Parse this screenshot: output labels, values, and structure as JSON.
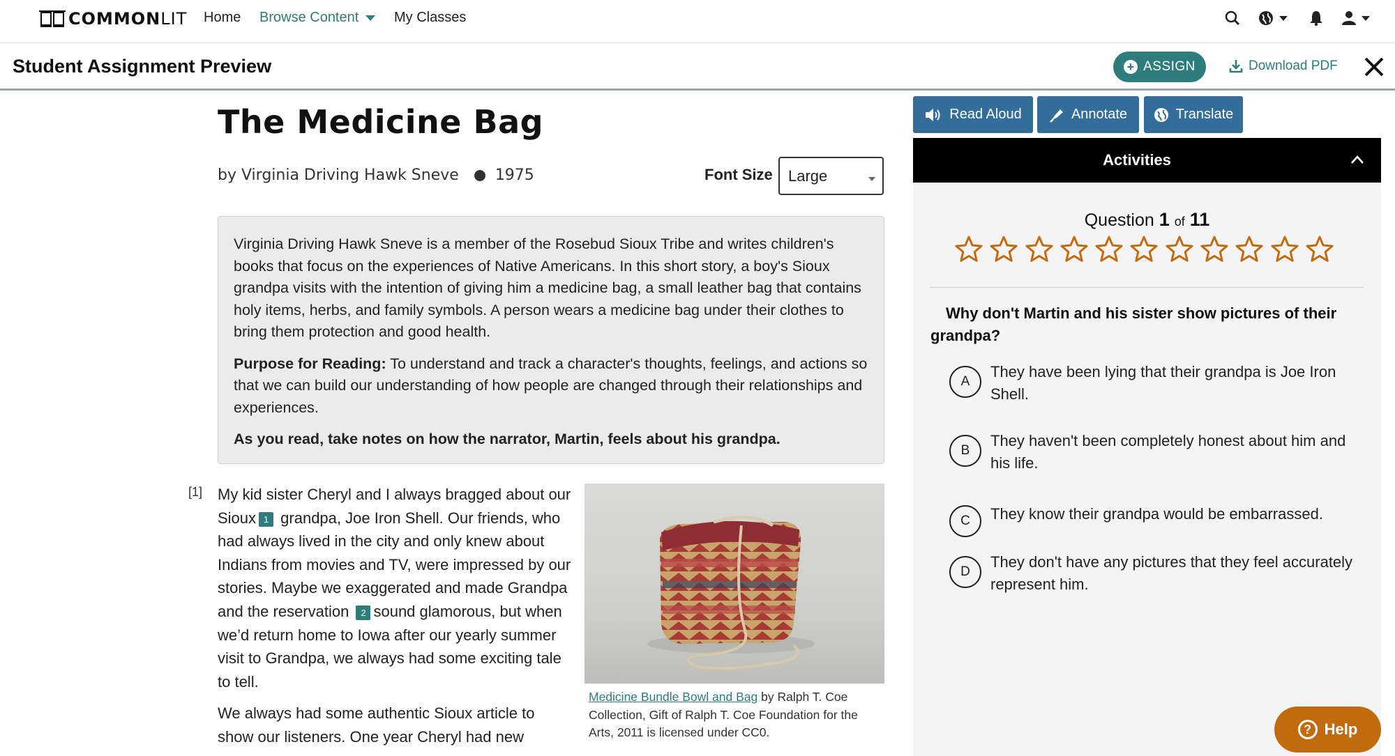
{
  "nav": {
    "logo_bold": "COMMON",
    "logo_light": "LIT",
    "links": [
      "Home",
      "Browse Content",
      "My Classes"
    ]
  },
  "subheader": {
    "title": "Student Assignment Preview",
    "assign_label": "ASSIGN",
    "download_label": "Download PDF"
  },
  "text": {
    "title": "The Medicine Bag",
    "author": "by Virginia Driving Hawk Sneve",
    "year": "1975",
    "font_size_label": "Font Size",
    "font_size_value": "Large",
    "intro": "Virginia Driving Hawk Sneve is a member of the Rosebud Sioux Tribe and writes children's books that focus on the experiences of Native Americans. In this short story, a boy's Sioux grandpa visits with the intention of giving him a medicine bag, a small leather bag that contains holy items, herbs, and family symbols. A person wears a medicine bag under their clothes to bring them protection and good health.",
    "purpose_label": "Purpose for Reading:",
    "purpose_text": " To understand and track a character's thoughts, feelings, and actions so that we can build our understanding of how people are changed through their relationships and experiences.",
    "instruction": "As you read, take notes on how the narrator, Martin, feels about his grandpa.",
    "para_number": "[1]",
    "p1_a": "My kid sister Cheryl and I always bragged about our Sioux",
    "fn1": "1",
    "p1_b": " grandpa, Joe Iron Shell. Our friends, who had always lived in the city and only knew about Indians from movies and TV, were impressed by our stories. Maybe we exaggerated and made Grandpa and the reservation ",
    "fn2": "2",
    "p1_c": "sound glamorous, but when we’d return home to Iowa after our yearly summer visit to Grandpa, we always had some exciting tale to tell.",
    "p2": "We always had some authentic Sioux article to show our listeners. One year Cheryl had new",
    "caption_link": "Medicine Bundle Bowl and Bag",
    "caption_rest": " by Ralph T. Coe Collection, Gift of Ralph T. Coe Foundation for the Arts, 2011 is licensed under CC0."
  },
  "tools": {
    "read_aloud": "Read Aloud",
    "annotate": "Annotate",
    "translate": "Translate"
  },
  "activities": {
    "header": "Activities",
    "question_word": "Question",
    "current": "1",
    "of_word": "of",
    "total": "11",
    "question": "Why don't Martin and his sister show pictures of their grandpa?",
    "choices": [
      {
        "letter": "A",
        "text": "They have been lying that their grandpa is Joe Iron Shell."
      },
      {
        "letter": "B",
        "text": "They haven't been completely honest about him and his life."
      },
      {
        "letter": "C",
        "text": "They know their grandpa would be embarrassed."
      },
      {
        "letter": "D",
        "text": "They don't have any pictures that they feel accurately represent him."
      }
    ]
  },
  "help": {
    "label": "Help"
  },
  "colors": {
    "teal": "#2e7d7c",
    "tool_blue": "#336e9a",
    "star_orange": "#c46a0c",
    "help_orange": "#c26b0e"
  }
}
